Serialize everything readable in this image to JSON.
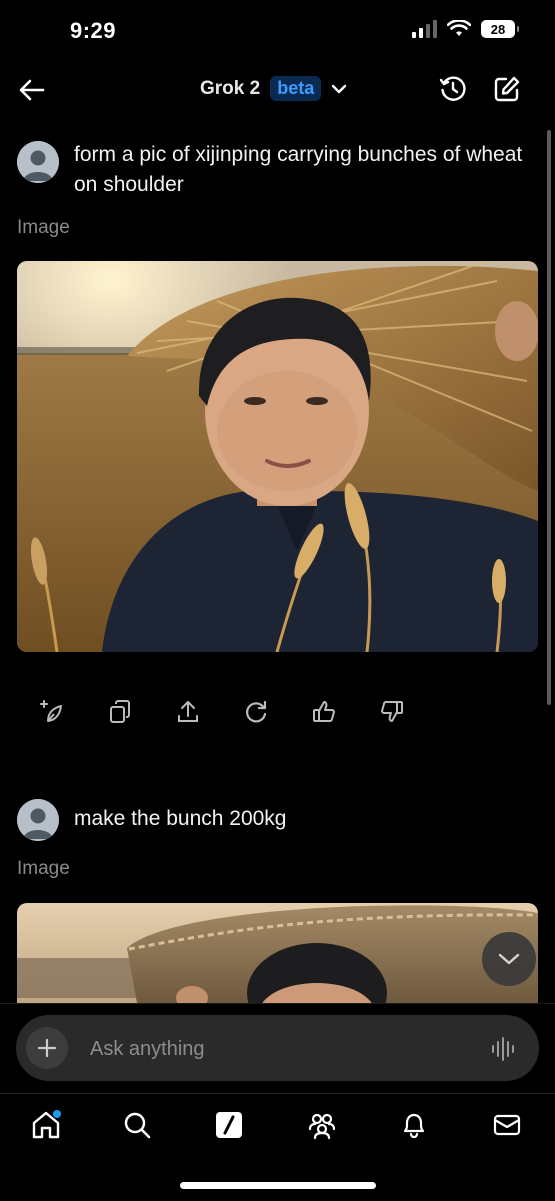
{
  "status_bar": {
    "time": "9:29",
    "battery": "28"
  },
  "header": {
    "title": "Grok 2",
    "badge": "beta"
  },
  "messages": [
    {
      "prompt": "form a pic of xijinping carrying bunches of wheat on shoulder",
      "result_label": "Image"
    },
    {
      "prompt": "make the bunch 200kg",
      "result_label": "Image"
    }
  ],
  "actions": [
    "sparkle-edit-icon",
    "copy-icon",
    "share-icon",
    "regenerate-icon",
    "thumbs-up-icon",
    "thumbs-down-icon"
  ],
  "input": {
    "placeholder": "Ask anything"
  },
  "nav": [
    "home-icon",
    "search-icon",
    "grok-icon",
    "communities-icon",
    "notifications-icon",
    "messages-icon"
  ],
  "colors": {
    "accent": "#1d9bf0",
    "beta_bg": "#0a2a52",
    "beta_text": "#3b9cff"
  }
}
